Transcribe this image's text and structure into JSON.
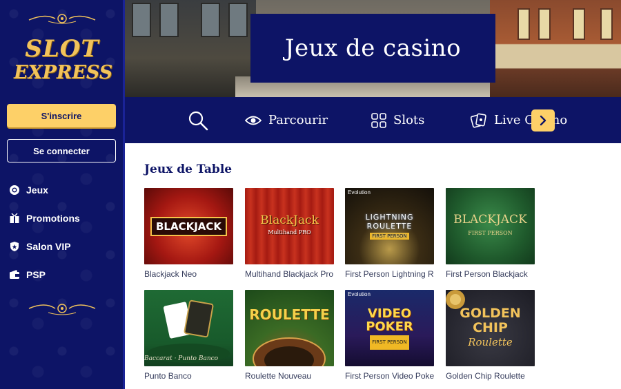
{
  "brand": {
    "logo_line1": "SLOT",
    "logo_line2": "EXPRESS",
    "gold": "#f2c35b",
    "navy": "#0d1466"
  },
  "sidebar": {
    "signup_label": "S'inscrire",
    "login_label": "Se connecter",
    "items": [
      {
        "label": "Jeux",
        "icon": "chip-icon"
      },
      {
        "label": "Promotions",
        "icon": "gift-icon"
      },
      {
        "label": "Salon VIP",
        "icon": "shield-icon"
      },
      {
        "label": "PSP",
        "icon": "wallet-icon"
      }
    ]
  },
  "hero": {
    "title": "Jeux de casino"
  },
  "categories": {
    "search_icon": "search-icon",
    "items": [
      {
        "label": "Parcourir",
        "icon": "eye-icon"
      },
      {
        "label": "Slots",
        "icon": "grid-icon"
      },
      {
        "label": "Live Casino",
        "icon": "cards-icon"
      }
    ],
    "scroll_icon": "chevron-right-icon"
  },
  "section": {
    "title": "Jeux de Table",
    "games": [
      {
        "name": "Blackjack Neo",
        "art": "BLACKJACK"
      },
      {
        "name": "Multihand Blackjack Pro",
        "art": "BlackJack",
        "art_sub": "Multihand PRO"
      },
      {
        "name": "First Person Lightning Roulette",
        "art": "LIGHTNING ROULETTE",
        "badge": "FIRST PERSON",
        "provider": "Evolution"
      },
      {
        "name": "First Person Blackjack",
        "art": "BLACKJACK",
        "art_sub": "FIRST PERSON"
      },
      {
        "name": "Punto Banco",
        "art": "Baccarat · Punto Banco"
      },
      {
        "name": "Roulette Nouveau",
        "art": "ROULETTE"
      },
      {
        "name": "First Person Video Poker",
        "art": "VIDEO POKER",
        "badge": "FIRST PERSON",
        "provider": "Evolution"
      },
      {
        "name": "Golden Chip Roulette",
        "art": "GOLDEN CHIP",
        "art_sub": "Roulette"
      }
    ]
  }
}
